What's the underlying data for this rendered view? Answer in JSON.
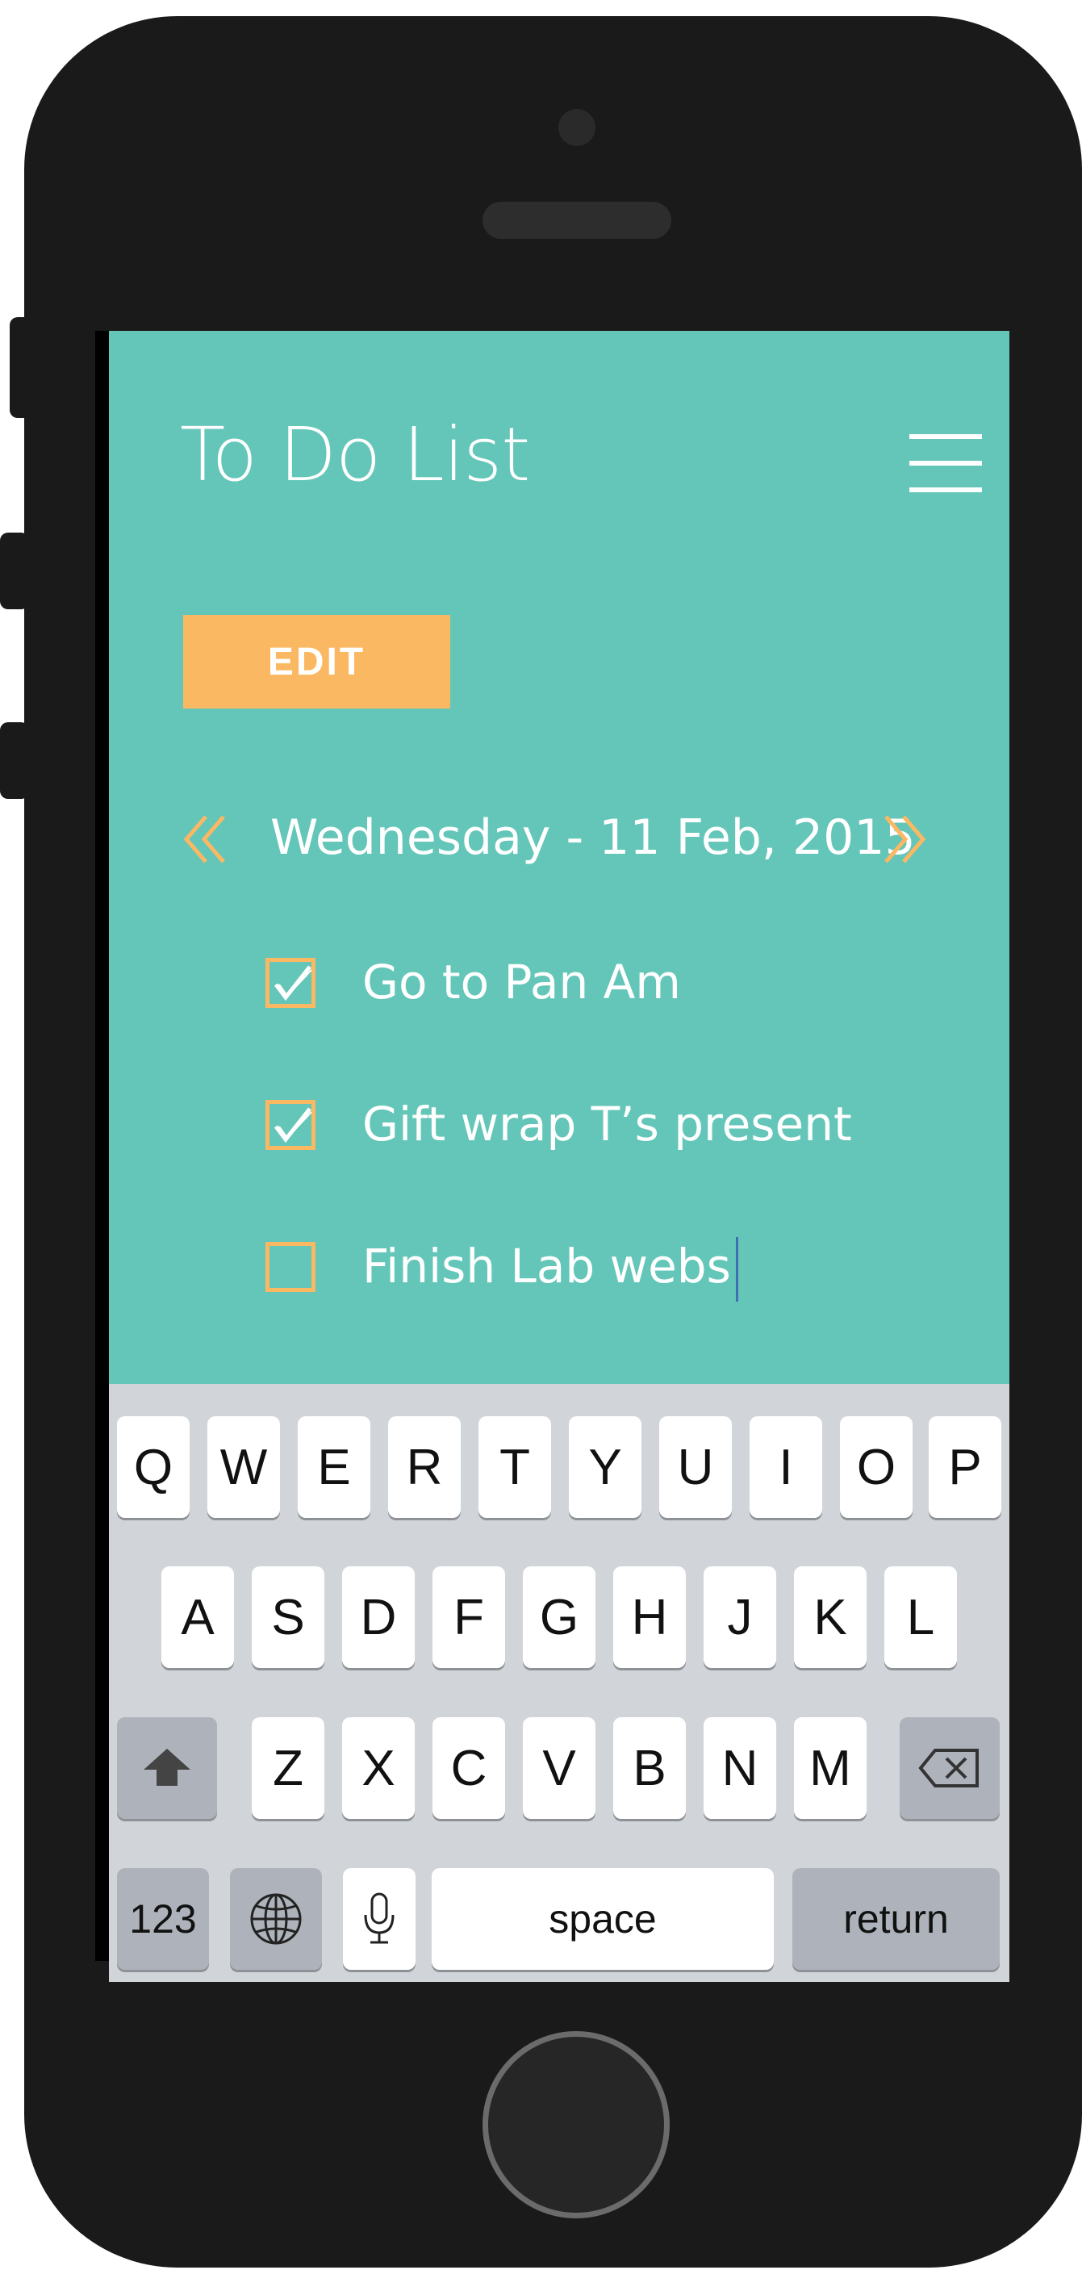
{
  "app": {
    "title": "To Do List",
    "edit_label": "EDIT"
  },
  "date": {
    "label": "Wednesday - 11 Feb, 2015"
  },
  "tasks": [
    {
      "text": "Go to Pan Am",
      "checked": true
    },
    {
      "text": "Gift wrap T’s present",
      "checked": true
    },
    {
      "text": "Finish Lab webs",
      "checked": false
    }
  ],
  "keyboard": {
    "row1": [
      "Q",
      "W",
      "E",
      "R",
      "T",
      "Y",
      "U",
      "I",
      "O",
      "P"
    ],
    "row2": [
      "A",
      "S",
      "D",
      "F",
      "G",
      "H",
      "J",
      "K",
      "L"
    ],
    "row3": [
      "Z",
      "X",
      "C",
      "V",
      "B",
      "N",
      "M"
    ],
    "numbers_label": "123",
    "space_label": "space",
    "return_label": "return"
  },
  "icons": {
    "menu": "hamburger-icon",
    "prev": "double-chevron-left-icon",
    "next": "double-chevron-right-icon",
    "shift": "shift-arrow-icon",
    "delete": "backspace-icon",
    "globe": "globe-icon",
    "mic": "microphone-icon"
  },
  "colors": {
    "background": "#63c6b9",
    "accent": "#fbb863",
    "text": "#ffffff",
    "keyboard_bg": "#d1d5da"
  }
}
